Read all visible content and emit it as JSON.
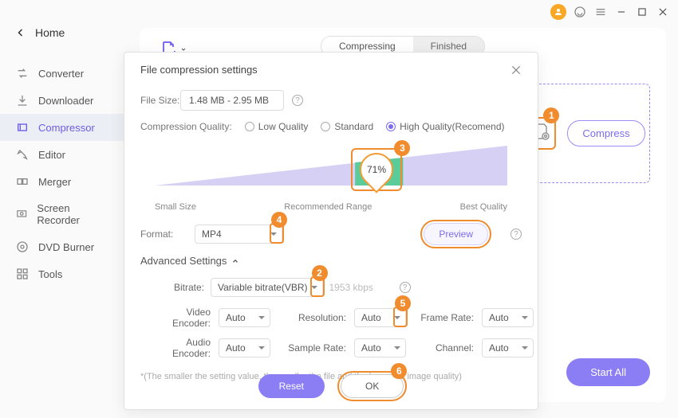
{
  "window": {
    "home": "Home"
  },
  "sidebar": {
    "items": [
      {
        "label": "Converter",
        "icon": "converter"
      },
      {
        "label": "Downloader",
        "icon": "download"
      },
      {
        "label": "Compressor",
        "icon": "compressor",
        "active": true
      },
      {
        "label": "Editor",
        "icon": "editor"
      },
      {
        "label": "Merger",
        "icon": "merger"
      },
      {
        "label": "Screen Recorder",
        "icon": "screen"
      },
      {
        "label": "DVD Burner",
        "icon": "dvd"
      },
      {
        "label": "Tools",
        "icon": "tools"
      }
    ]
  },
  "main": {
    "tabs": {
      "compressing": "Compressing",
      "finished": "Finished"
    },
    "compress_btn": "Compress",
    "start_all": "Start All"
  },
  "dialog": {
    "title": "File compression settings",
    "filesize_label": "File Size:",
    "filesize_value": "1.48 MB - 2.95 MB",
    "cq_label": "Compression Quality:",
    "cq_low": "Low Quality",
    "cq_std": "Standard",
    "cq_high": "High Quality(Recomend)",
    "slider": {
      "percent": "71%",
      "small": "Small Size",
      "rec": "Recommended Range",
      "best": "Best Quality",
      "percent_pos": 63
    },
    "format_label": "Format:",
    "format_value": "MP4",
    "preview": "Preview",
    "adv_title": "Advanced Settings",
    "bitrate_label": "Bitrate:",
    "bitrate_value": "Variable bitrate(VBR)",
    "bitrate_kbps": "1953 kbps",
    "venc_label": "Video Encoder:",
    "venc_value": "Auto",
    "res_label": "Resolution:",
    "res_value": "Auto",
    "fr_label": "Frame Rate:",
    "fr_value": "Auto",
    "aenc_label": "Audio Encoder:",
    "aenc_value": "Auto",
    "sr_label": "Sample Rate:",
    "sr_value": "Auto",
    "ch_label": "Channel:",
    "ch_value": "Auto",
    "note": "*(The smaller the setting value, the smaller the file and the lower the image quality)",
    "reset": "Reset",
    "ok": "OK"
  },
  "annotations": {
    "n1": "1",
    "n2": "2",
    "n3": "3",
    "n4": "4",
    "n5": "5",
    "n6": "6"
  }
}
